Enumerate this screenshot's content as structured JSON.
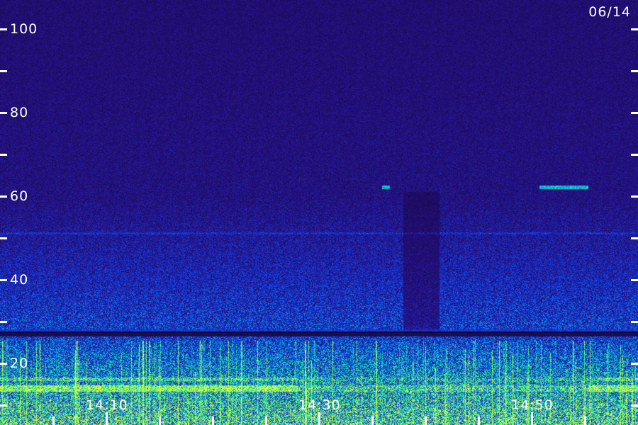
{
  "date": "06/14",
  "chart_data": {
    "type": "heatmap",
    "title": "",
    "xlabel": "",
    "ylabel": "",
    "y_ticks": [
      "100",
      "80",
      "60",
      "40",
      "20"
    ],
    "x_ticks": [
      "14:10",
      "14:30",
      "14:50"
    ],
    "colors": {
      "background": "#1e0c4e",
      "low": "#2a1a92",
      "mid": "#1e5cff",
      "high": "#5cff7a",
      "peak": "#e8ff4a"
    }
  }
}
